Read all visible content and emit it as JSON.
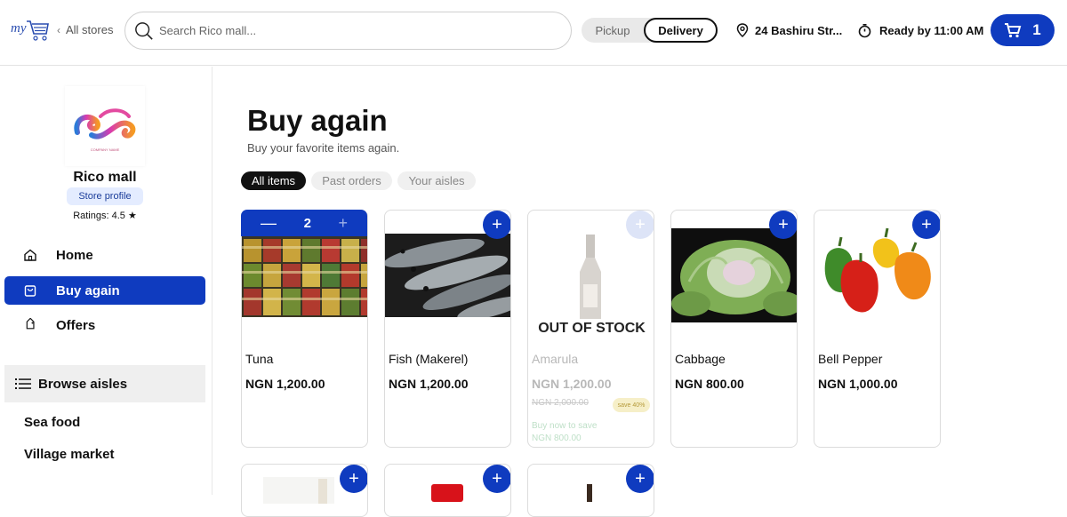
{
  "header": {
    "all_stores": "All stores",
    "search_placeholder": "Search Rico mall...",
    "pickup": "Pickup",
    "delivery": "Delivery",
    "address": "24 Bashiru Str...",
    "ready": "Ready by 11:00 AM",
    "cart_count": "1",
    "accent": "#0f3bbf"
  },
  "store": {
    "name": "Rico mall",
    "profile_label": "Store profile",
    "ratings": "Ratings: 4.5 ★",
    "logo_caption": "COMPANY NAME"
  },
  "nav": {
    "home": "Home",
    "buy_again": "Buy again",
    "offers": "Offers",
    "browse_aisles": "Browse aisles",
    "aisles": [
      "Sea food",
      "Village market"
    ]
  },
  "main": {
    "title": "Buy again",
    "subtitle": "Buy your favorite items again.",
    "tabs": [
      "All items",
      "Past orders",
      "Your aisles"
    ]
  },
  "products": [
    {
      "name": "Tuna",
      "price": "NGN 1,200.00",
      "qty": "2"
    },
    {
      "name": "Fish (Makerel)",
      "price": "NGN 1,200.00"
    },
    {
      "name": "Amarula",
      "price": "NGN 1,200.00",
      "status": "OUT OF STOCK",
      "old_price": "NGN 2,000.00",
      "save": "save 40%",
      "buy_now": "Buy now to save",
      "buy_now_price": "NGN 800.00"
    },
    {
      "name": "Cabbage",
      "price": "NGN 800.00"
    },
    {
      "name": "Bell Pepper",
      "price": "NGN 1,000.00"
    }
  ]
}
